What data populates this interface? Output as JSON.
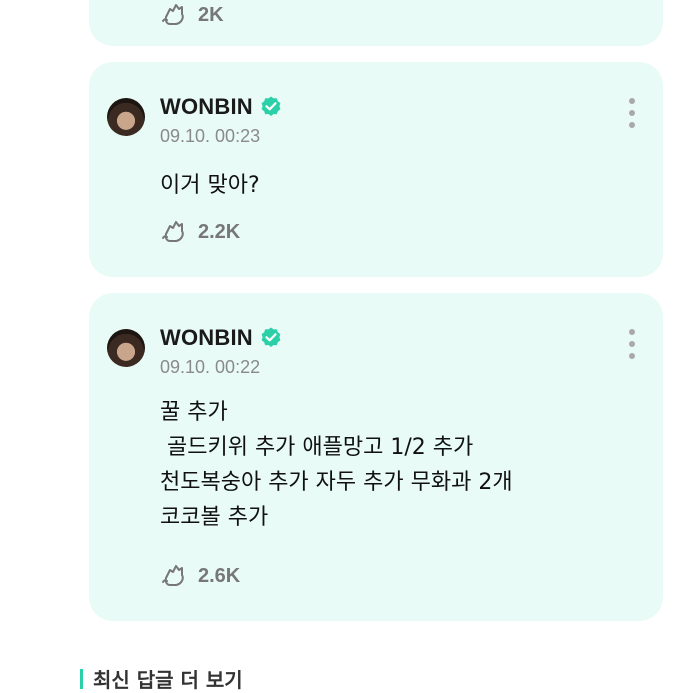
{
  "partial_post": {
    "reaction_count": "2K"
  },
  "posts": [
    {
      "author": "WONBIN",
      "timestamp": "09.10. 00:23",
      "text": "이거 맞아?",
      "reaction_count": "2.2K"
    },
    {
      "author": "WONBIN",
      "timestamp": "09.10. 00:22",
      "text": "꿀 추가\n 골드키위 추가 애플망고 1/2 추가\n천도복숭아 추가 자두 추가 무화과 2개\n코코볼 추가",
      "reaction_count": "2.6K"
    }
  ],
  "footer": {
    "link_label": "최신 답글 더 보기"
  },
  "colors": {
    "card_bg": "#e9fbf6",
    "accent": "#2bd0a8",
    "verified": "#2bd0a8"
  },
  "icons": [
    "verified-badge-icon",
    "more-options-icon",
    "reaction-icon"
  ]
}
